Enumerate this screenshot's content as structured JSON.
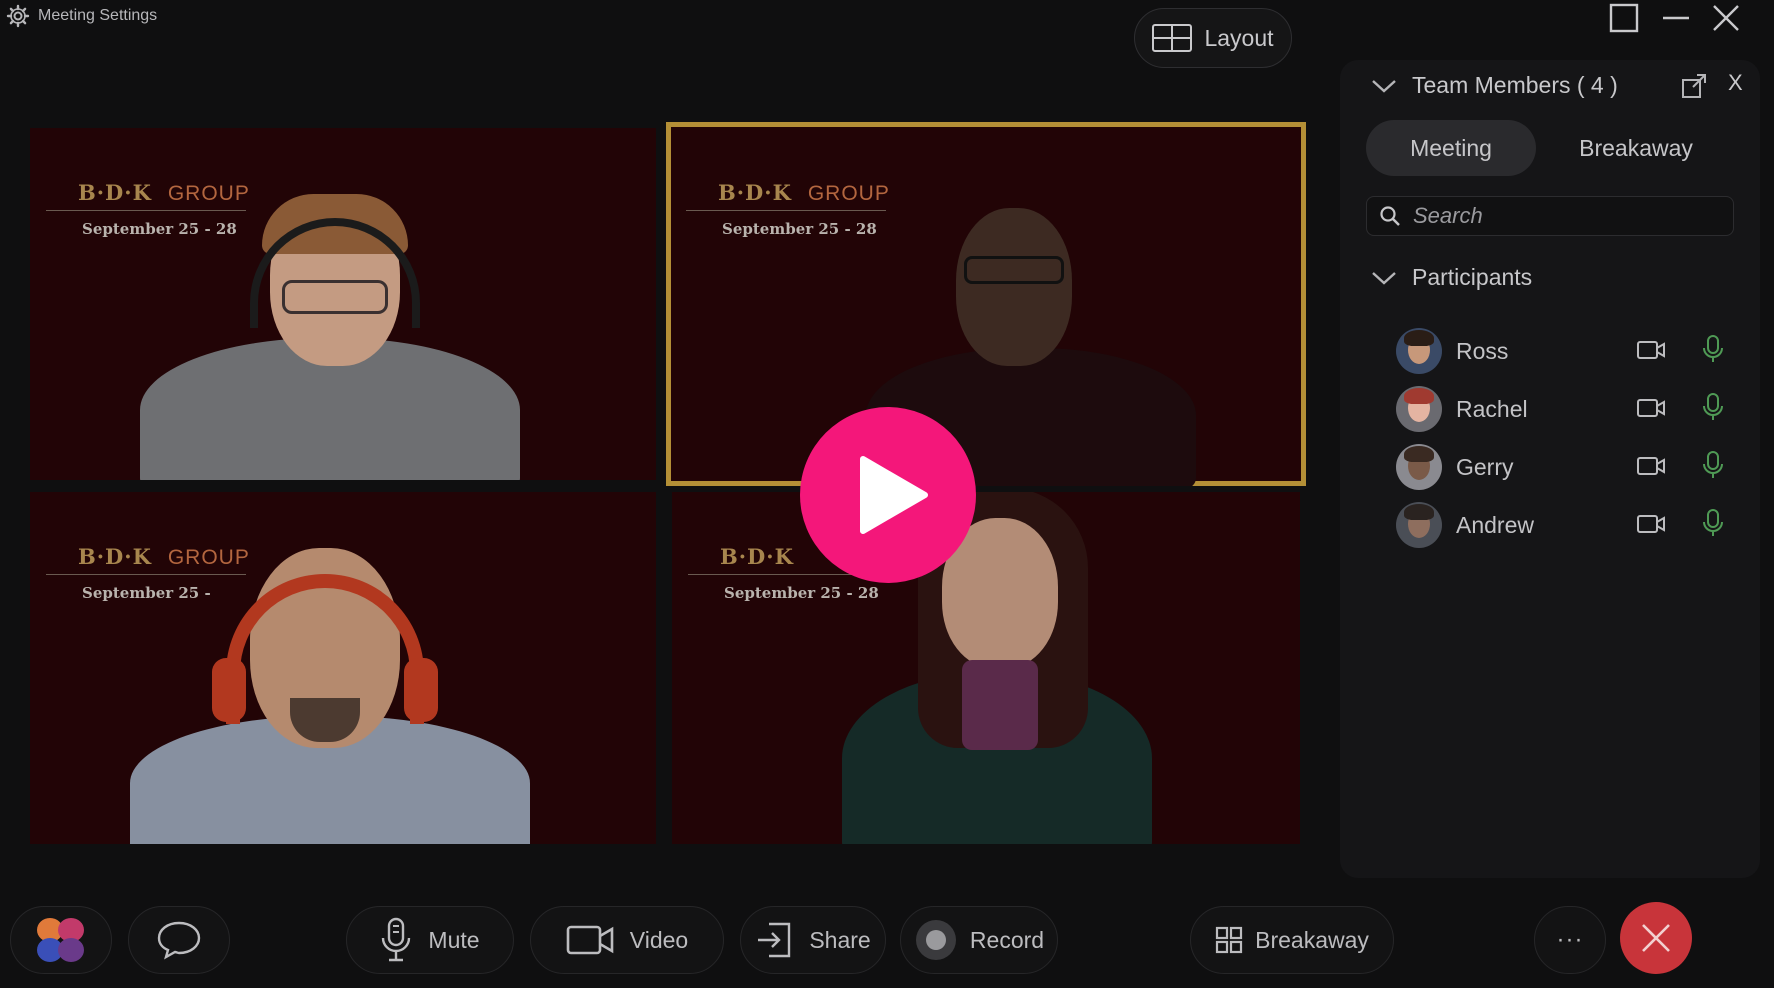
{
  "app": {
    "meeting_settings_label": "Meeting Settings",
    "layout_label": "Layout"
  },
  "tiles": [
    {
      "brand": "B·D·K",
      "group": "GROUP",
      "dates": "September 25 - 28",
      "active": false
    },
    {
      "brand": "B·D·K",
      "group": "GROUP",
      "dates": "September 25 - 28",
      "active": true
    },
    {
      "brand": "B·D·K",
      "group": "GROUP",
      "dates": "September 25 - ",
      "active": false
    },
    {
      "brand": "B·D·K",
      "group": "",
      "dates": "September 25 - 28",
      "active": false
    }
  ],
  "panel": {
    "title": "Team Members ( 4 )",
    "close_label": "X",
    "tabs": [
      {
        "label": "Meeting",
        "selected": true
      },
      {
        "label": "Breakaway",
        "selected": false
      }
    ],
    "search_placeholder": "Search",
    "participants_label": "Participants",
    "participants": [
      {
        "name": "Ross"
      },
      {
        "name": "Rachel"
      },
      {
        "name": "Gerry"
      },
      {
        "name": "Andrew"
      }
    ]
  },
  "toolbar": {
    "mute_label": "Mute",
    "video_label": "Video",
    "share_label": "Share",
    "record_label": "Record",
    "breakaway_label": "Breakaway",
    "more_label": "···"
  },
  "colors": {
    "accent_play": "#f4177a",
    "active_tile_border": "#b48f36",
    "mic_active": "#4f9a55",
    "end_call": "#c8343a",
    "tile_background": "#220406"
  },
  "icons": {
    "settings": "gear-icon",
    "layout": "grid-layout-icon",
    "maximize": "maximize-icon",
    "minimize": "minimize-icon",
    "close": "close-icon",
    "play": "play-icon",
    "collapse": "chevron-down-icon",
    "popout": "popout-icon",
    "search": "search-icon",
    "camera": "camera-icon",
    "microphone": "microphone-icon",
    "app_logo": "app-logo-icon",
    "chat": "chat-bubble-icon",
    "share": "share-icon",
    "record": "record-icon",
    "breakaway": "breakaway-grid-icon",
    "end_call": "end-call-icon"
  }
}
